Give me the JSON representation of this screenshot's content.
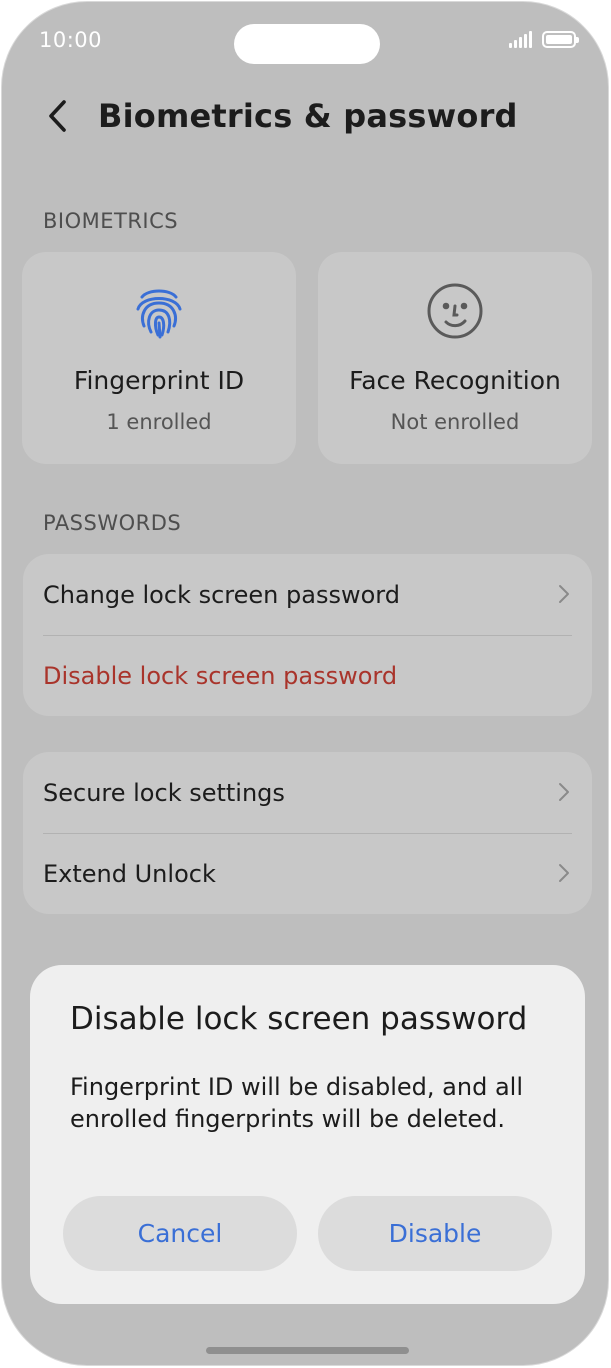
{
  "status_bar": {
    "time": "10:00",
    "icons": [
      "signal-icon",
      "battery-icon"
    ]
  },
  "header": {
    "back_icon": "chevron-left-icon",
    "title": "Biometrics & password"
  },
  "biometrics": {
    "section_label": "BIOMETRICS",
    "cards": [
      {
        "icon": "fingerprint-icon",
        "name": "Fingerprint ID",
        "status": "1 enrolled"
      },
      {
        "icon": "face-icon",
        "name": "Face Recognition",
        "status": "Not enrolled"
      }
    ]
  },
  "passwords": {
    "section_label": "PASSWORDS",
    "items": [
      {
        "label": "Change lock screen password",
        "has_chevron": true
      },
      {
        "label": "Disable lock screen password",
        "has_chevron": false
      }
    ]
  },
  "security": {
    "items": [
      {
        "label": "Secure lock settings",
        "has_chevron": true
      },
      {
        "label": "Extend Unlock",
        "has_chevron": true
      }
    ]
  },
  "dialog": {
    "title": "Disable lock screen password",
    "body": "Fingerprint ID will be disabled, and all enrolled fingerprints will be deleted.",
    "cancel_label": "Cancel",
    "confirm_label": "Disable"
  },
  "colors": {
    "accent": "#3a6fd6",
    "danger": "#a9342b",
    "scrim_background": "#bebebe",
    "dialog_background": "#efefef"
  }
}
